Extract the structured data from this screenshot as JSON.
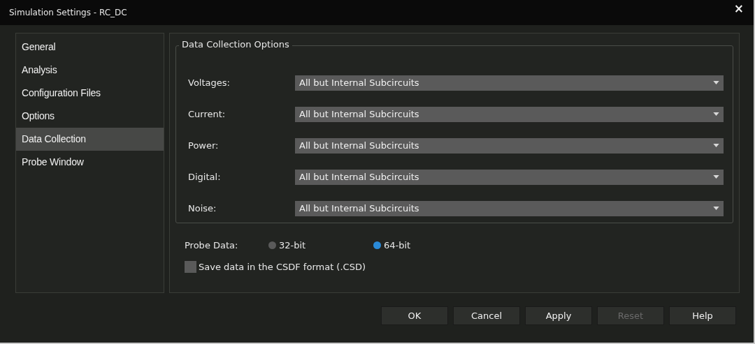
{
  "window": {
    "title": "Simulation Settings - RC_DC",
    "close": "×"
  },
  "sidebar": {
    "items": [
      {
        "label": "General",
        "selected": false
      },
      {
        "label": "Analysis",
        "selected": false
      },
      {
        "label": "Configuration Files",
        "selected": false
      },
      {
        "label": "Options",
        "selected": false
      },
      {
        "label": "Data Collection",
        "selected": true
      },
      {
        "label": "Probe Window",
        "selected": false
      }
    ]
  },
  "group": {
    "title": "Data Collection Options",
    "fields": [
      {
        "label": "Voltages:",
        "value": "All but Internal Subcircuits"
      },
      {
        "label": "Current:",
        "value": "All but Internal Subcircuits"
      },
      {
        "label": "Power:",
        "value": "All but Internal Subcircuits"
      },
      {
        "label": "Digital:",
        "value": "All but Internal Subcircuits"
      },
      {
        "label": "Noise:",
        "value": "All but Internal Subcircuits"
      }
    ]
  },
  "probe_data": {
    "label": "Probe Data:",
    "options": [
      {
        "label": "32-bit",
        "selected": false
      },
      {
        "label": "64-bit",
        "selected": true
      }
    ]
  },
  "csdf": {
    "label": "Save data in the CSDF format (.CSD)",
    "checked": false
  },
  "buttons": [
    {
      "label": "OK",
      "disabled": false
    },
    {
      "label": "Cancel",
      "disabled": false
    },
    {
      "label": "Apply",
      "disabled": false
    },
    {
      "label": "Reset",
      "disabled": true
    },
    {
      "label": "Help",
      "disabled": false
    }
  ]
}
